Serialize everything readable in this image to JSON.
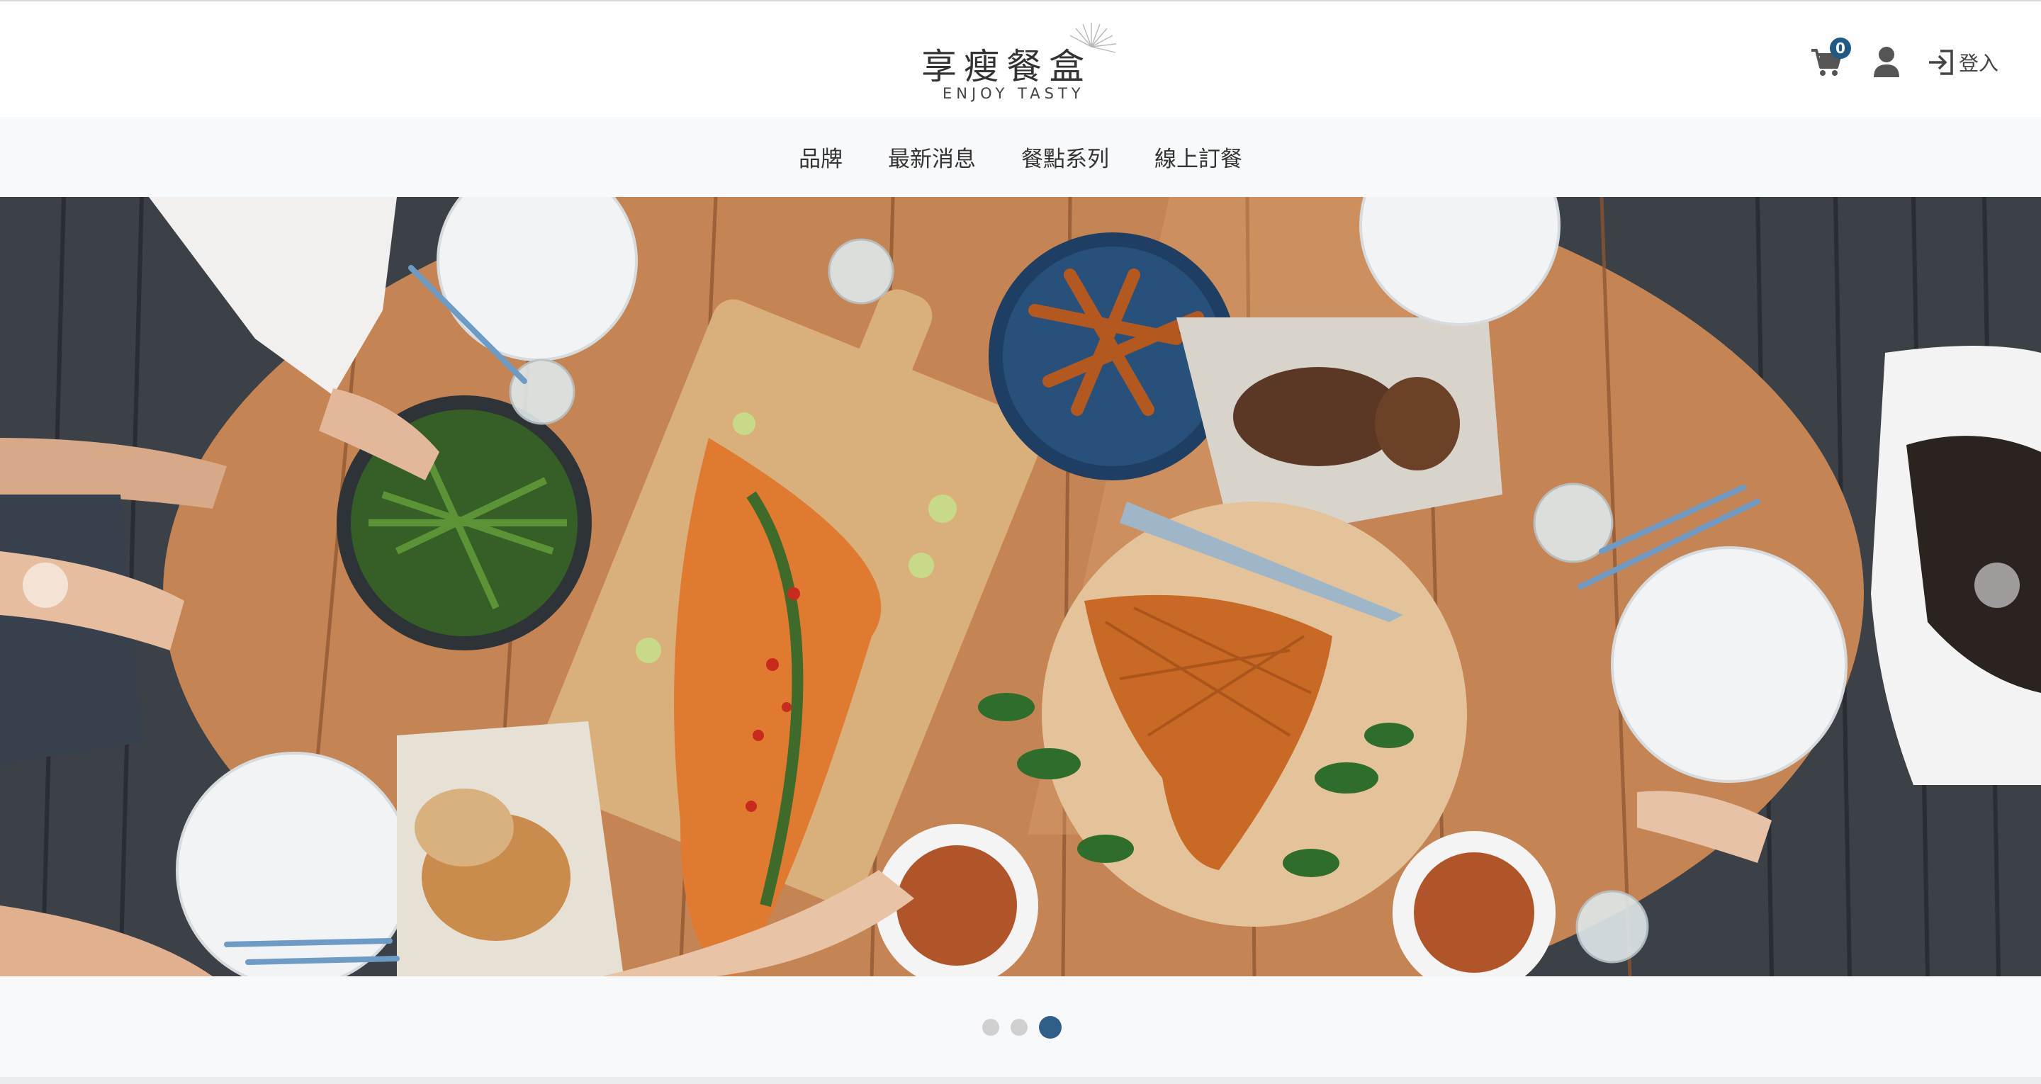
{
  "brand": {
    "title": "享瘦餐盒",
    "subtitle": "ENJOY TASTY"
  },
  "header": {
    "cart_count": "0",
    "login_label": "登入",
    "icons": [
      "cart-icon",
      "user-icon",
      "login-icon"
    ]
  },
  "nav": {
    "items": [
      "品牌",
      "最新消息",
      "餐點系列",
      "線上訂餐"
    ]
  },
  "carousel": {
    "slide_count": 3,
    "active_index": 3,
    "hero_image": "overhead view of an outdoor wooden table with salmon, vegetables, bread and plates"
  },
  "colors": {
    "accent": "#2f5f86",
    "badge": "#1f5a86",
    "nav_bg": "#f8f9fa"
  }
}
